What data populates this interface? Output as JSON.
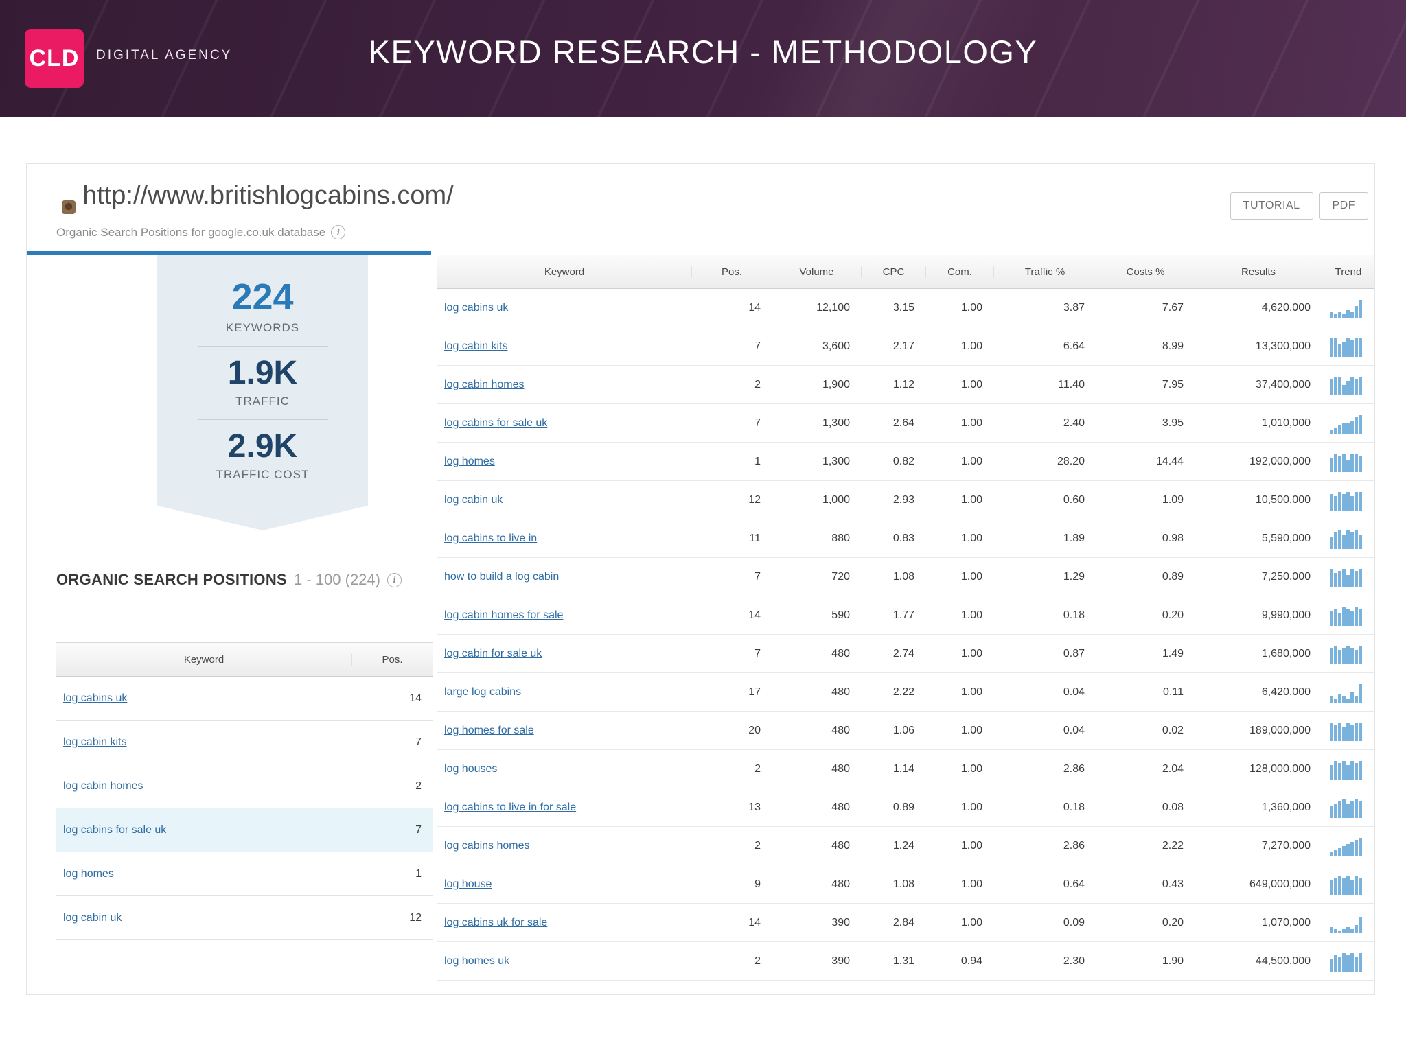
{
  "slide": {
    "title": "KEYWORD RESEARCH - METHODOLOGY",
    "logo_text": "CLD",
    "logo_caption": "DIGITAL AGENCY"
  },
  "report": {
    "url": "http://www.britishlogcabins.com/",
    "subtitle": "Organic Search Positions for google.co.uk database",
    "buttons": {
      "tutorial": "TUTORIAL",
      "pdf": "PDF"
    },
    "summary": {
      "keywords_value": "224",
      "keywords_label": "KEYWORDS",
      "traffic_value": "1.9K",
      "traffic_label": "TRAFFIC",
      "traffic_cost_value": "2.9K",
      "traffic_cost_label": "TRAFFIC COST"
    },
    "section": {
      "heading": "ORGANIC SEARCH POSITIONS",
      "range": "1 - 100 (224)"
    },
    "left_table": {
      "headers": [
        "Keyword",
        "Pos."
      ],
      "rows": [
        {
          "keyword": "log cabins uk",
          "pos": "14"
        },
        {
          "keyword": "log cabin kits",
          "pos": "7"
        },
        {
          "keyword": "log cabin homes",
          "pos": "2"
        },
        {
          "keyword": "log cabins for sale uk",
          "pos": "7",
          "highlight": true
        },
        {
          "keyword": "log homes",
          "pos": "1"
        },
        {
          "keyword": "log cabin uk",
          "pos": "12"
        }
      ]
    },
    "main_table": {
      "headers": [
        "Keyword",
        "Pos.",
        "Volume",
        "CPC",
        "Com.",
        "Traffic %",
        "Costs %",
        "Results",
        "Trend"
      ],
      "rows": [
        {
          "keyword": "log cabins uk",
          "pos": "14",
          "volume": "12,100",
          "cpc": "3.15",
          "com": "1.00",
          "traffic": "3.87",
          "costs": "7.67",
          "results": "4,620,000",
          "trend": [
            3,
            2,
            3,
            2,
            4,
            3,
            6,
            9
          ]
        },
        {
          "keyword": "log cabin kits",
          "pos": "7",
          "volume": "3,600",
          "cpc": "2.17",
          "com": "1.00",
          "traffic": "6.64",
          "costs": "8.99",
          "results": "13,300,000",
          "trend": [
            9,
            9,
            6,
            7,
            9,
            8,
            9,
            9
          ]
        },
        {
          "keyword": "log cabin homes",
          "pos": "2",
          "volume": "1,900",
          "cpc": "1.12",
          "com": "1.00",
          "traffic": "11.40",
          "costs": "7.95",
          "results": "37,400,000",
          "trend": [
            8,
            9,
            9,
            5,
            7,
            9,
            8,
            9
          ]
        },
        {
          "keyword": "log cabins for sale uk",
          "pos": "7",
          "volume": "1,300",
          "cpc": "2.64",
          "com": "1.00",
          "traffic": "2.40",
          "costs": "3.95",
          "results": "1,010,000",
          "trend": [
            2,
            3,
            4,
            5,
            5,
            6,
            8,
            9
          ]
        },
        {
          "keyword": "log homes",
          "pos": "1",
          "volume": "1,300",
          "cpc": "0.82",
          "com": "1.00",
          "traffic": "28.20",
          "costs": "14.44",
          "results": "192,000,000",
          "trend": [
            7,
            9,
            8,
            9,
            6,
            9,
            9,
            8
          ]
        },
        {
          "keyword": "log cabin uk",
          "pos": "12",
          "volume": "1,000",
          "cpc": "2.93",
          "com": "1.00",
          "traffic": "0.60",
          "costs": "1.09",
          "results": "10,500,000",
          "trend": [
            8,
            7,
            9,
            8,
            9,
            7,
            9,
            9
          ]
        },
        {
          "keyword": "log cabins to live in",
          "pos": "11",
          "volume": "880",
          "cpc": "0.83",
          "com": "1.00",
          "traffic": "1.89",
          "costs": "0.98",
          "results": "5,590,000",
          "trend": [
            6,
            8,
            9,
            7,
            9,
            8,
            9,
            7
          ]
        },
        {
          "keyword": "how to build a log cabin",
          "pos": "7",
          "volume": "720",
          "cpc": "1.08",
          "com": "1.00",
          "traffic": "1.29",
          "costs": "0.89",
          "results": "7,250,000",
          "trend": [
            9,
            7,
            8,
            9,
            6,
            9,
            8,
            9
          ]
        },
        {
          "keyword": "log cabin homes for sale",
          "pos": "14",
          "volume": "590",
          "cpc": "1.77",
          "com": "1.00",
          "traffic": "0.18",
          "costs": "0.20",
          "results": "9,990,000",
          "trend": [
            7,
            8,
            6,
            9,
            8,
            7,
            9,
            8
          ]
        },
        {
          "keyword": "log cabin for sale uk",
          "pos": "7",
          "volume": "480",
          "cpc": "2.74",
          "com": "1.00",
          "traffic": "0.87",
          "costs": "1.49",
          "results": "1,680,000",
          "trend": [
            8,
            9,
            7,
            8,
            9,
            8,
            7,
            9
          ]
        },
        {
          "keyword": "large log cabins",
          "pos": "17",
          "volume": "480",
          "cpc": "2.22",
          "com": "1.00",
          "traffic": "0.04",
          "costs": "0.11",
          "results": "6,420,000",
          "trend": [
            3,
            2,
            4,
            3,
            2,
            5,
            3,
            9
          ]
        },
        {
          "keyword": "log homes for sale",
          "pos": "20",
          "volume": "480",
          "cpc": "1.06",
          "com": "1.00",
          "traffic": "0.04",
          "costs": "0.02",
          "results": "189,000,000",
          "trend": [
            9,
            8,
            9,
            7,
            9,
            8,
            9,
            9
          ]
        },
        {
          "keyword": "log houses",
          "pos": "2",
          "volume": "480",
          "cpc": "1.14",
          "com": "1.00",
          "traffic": "2.86",
          "costs": "2.04",
          "results": "128,000,000",
          "trend": [
            7,
            9,
            8,
            9,
            7,
            9,
            8,
            9
          ]
        },
        {
          "keyword": "log cabins to live in for sale",
          "pos": "13",
          "volume": "480",
          "cpc": "0.89",
          "com": "1.00",
          "traffic": "0.18",
          "costs": "0.08",
          "results": "1,360,000",
          "trend": [
            6,
            7,
            8,
            9,
            7,
            8,
            9,
            8
          ]
        },
        {
          "keyword": "log cabins homes",
          "pos": "2",
          "volume": "480",
          "cpc": "1.24",
          "com": "1.00",
          "traffic": "2.86",
          "costs": "2.22",
          "results": "7,270,000",
          "trend": [
            2,
            3,
            4,
            5,
            6,
            7,
            8,
            9
          ]
        },
        {
          "keyword": "log house",
          "pos": "9",
          "volume": "480",
          "cpc": "1.08",
          "com": "1.00",
          "traffic": "0.64",
          "costs": "0.43",
          "results": "649,000,000",
          "trend": [
            7,
            8,
            9,
            8,
            9,
            7,
            9,
            8
          ]
        },
        {
          "keyword": "log cabins uk for sale",
          "pos": "14",
          "volume": "390",
          "cpc": "2.84",
          "com": "1.00",
          "traffic": "0.09",
          "costs": "0.20",
          "results": "1,070,000",
          "trend": [
            3,
            2,
            1,
            2,
            3,
            2,
            4,
            8
          ]
        },
        {
          "keyword": "log homes uk",
          "pos": "2",
          "volume": "390",
          "cpc": "1.31",
          "com": "0.94",
          "traffic": "2.30",
          "costs": "1.90",
          "results": "44,500,000",
          "trend": [
            6,
            8,
            7,
            9,
            8,
            9,
            7,
            9
          ]
        }
      ]
    },
    "colors": {
      "brand_pink": "#ea1a63",
      "header_purple": "#402240",
      "accent_blue": "#2d7cb9",
      "link_blue": "#2e6da4",
      "trend_bar": "#79b2dd",
      "highlight_row": "#e7f5fb",
      "stat_bright_blue": "#2b7ab8",
      "stat_dark_blue": "#1f4468"
    }
  }
}
